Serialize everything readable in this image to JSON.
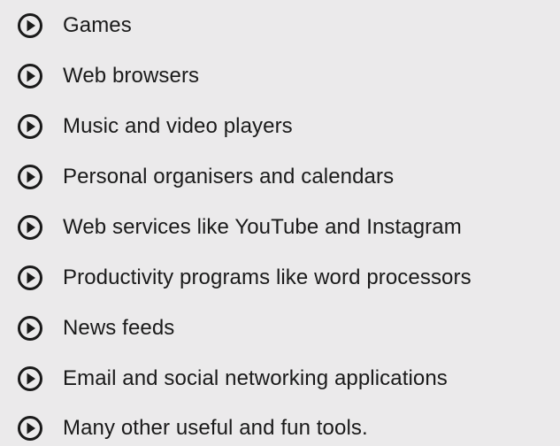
{
  "list": {
    "icon": "play-circle-icon",
    "icon_color": "#1a1a1a",
    "items": [
      {
        "label": "Games"
      },
      {
        "label": "Web browsers"
      },
      {
        "label": "Music and video players"
      },
      {
        "label": "Personal organisers and calendars"
      },
      {
        "label": "Web services like YouTube and Instagram"
      },
      {
        "label": "Productivity programs like word processors"
      },
      {
        "label": "News feeds"
      },
      {
        "label": "Email and social networking applications"
      },
      {
        "label": "Many other useful and fun tools."
      }
    ]
  }
}
